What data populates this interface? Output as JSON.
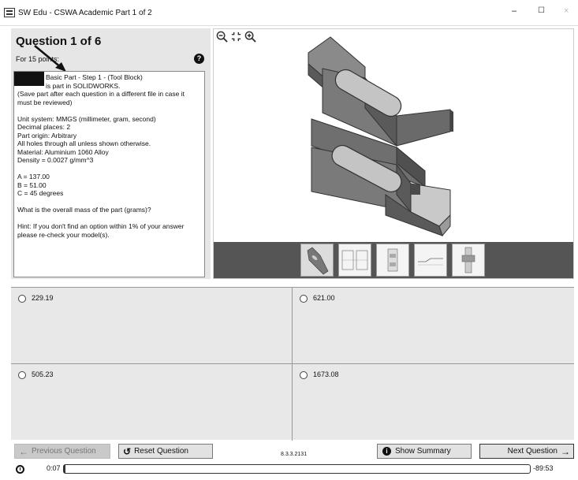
{
  "window": {
    "title": "SW Edu - CSWA Academic Part 1 of 2",
    "minimize": "–",
    "maximize": "☐",
    "close": "×"
  },
  "question": {
    "heading": "Question 1 of 6",
    "points": "For 15 points:",
    "help": "?",
    "lines": [
      "Basic Part - Step 1 - (Tool Block)",
      "is part in SOLIDWORKS.",
      "(Save part after each question in a different file in case it",
      "must be reviewed)",
      "",
      "Unit system: MMGS (millimeter, gram, second)",
      "Decimal places: 2",
      "Part origin: Arbitrary",
      "All holes through all unless shown otherwise.",
      "Material: Aluminium 1060 Alloy",
      "Density = 0.0027 g/mm^3",
      "",
      "A = 137.00",
      "B = 51.00",
      "C = 45 degrees",
      "",
      "What is the overall mass of the part (grams)?",
      "",
      "Hint: If you don't find an option within 1% of your answer",
      "please re-check your model(s)."
    ]
  },
  "answers": [
    {
      "label": "229.19"
    },
    {
      "label": "621.00"
    },
    {
      "label": "505.23"
    },
    {
      "label": "1673.08"
    }
  ],
  "nav": {
    "previous": "Previous Question",
    "reset": "Reset Question",
    "version": "8.3.3.2131",
    "summary": "Show Summary",
    "next": "Next Question"
  },
  "timer": {
    "elapsed": "0:07",
    "remaining": "-89:53",
    "progress_fraction": 0.002
  },
  "colors": {
    "part_dark": "#5a5a5a",
    "part_mid": "#8a8a8a",
    "part_light": "#c4c4c4",
    "thumb_strip": "#555555",
    "answer_bg": "#e8e8e8"
  }
}
